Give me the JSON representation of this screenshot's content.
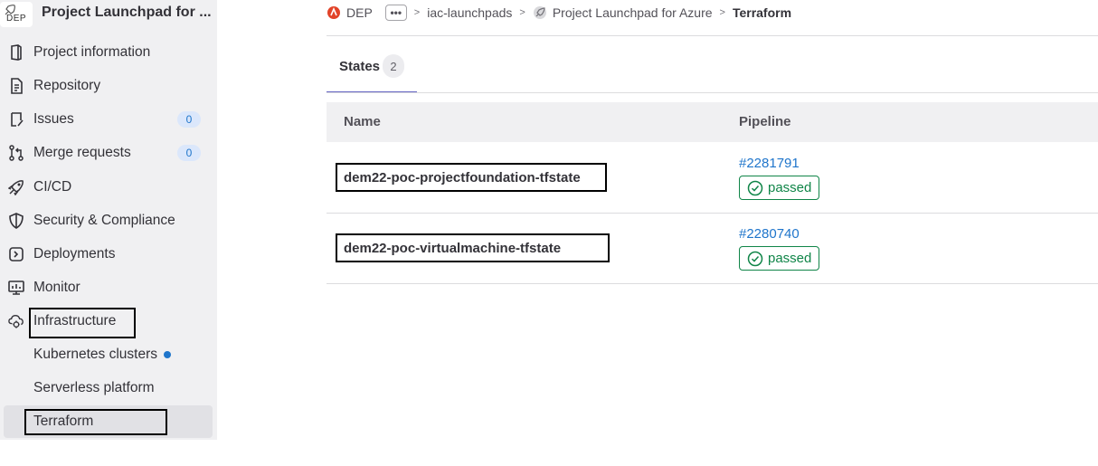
{
  "sidebar": {
    "project_avatar_text": "DEP",
    "project_title": "Project Launchpad for ...",
    "items": [
      {
        "label": "Project information",
        "icon": "project-info-icon"
      },
      {
        "label": "Repository",
        "icon": "repository-icon"
      },
      {
        "label": "Issues",
        "icon": "issues-icon",
        "badge": "0"
      },
      {
        "label": "Merge requests",
        "icon": "merge-request-icon",
        "badge": "0"
      },
      {
        "label": "CI/CD",
        "icon": "rocket-icon"
      },
      {
        "label": "Security & Compliance",
        "icon": "shield-icon"
      },
      {
        "label": "Deployments",
        "icon": "deployments-icon"
      },
      {
        "label": "Monitor",
        "icon": "monitor-icon"
      },
      {
        "label": "Infrastructure",
        "icon": "cloud-gear-icon"
      }
    ],
    "subitems": [
      {
        "label": "Kubernetes clusters",
        "has_dot": true
      },
      {
        "label": "Serverless platform"
      },
      {
        "label": "Terraform",
        "active": true
      }
    ]
  },
  "breadcrumb": {
    "group": "DEP",
    "ellipsis": "•••",
    "subgroup": "iac-launchpads",
    "project": "Project Launchpad for Azure",
    "current": "Terraform"
  },
  "tabs": {
    "states_label": "States",
    "states_count": "2"
  },
  "table": {
    "headers": {
      "name": "Name",
      "pipeline": "Pipeline"
    },
    "rows": [
      {
        "name": "dem22-poc-projectfoundation-tfstate",
        "pipeline": "#2281791",
        "status": "passed"
      },
      {
        "name": "dem22-poc-virtualmachine-tfstate",
        "pipeline": "#2280740",
        "status": "passed"
      }
    ]
  },
  "colors": {
    "accent": "#6666c4",
    "link": "#1f75cb",
    "success": "#108548",
    "sidebar_bg": "#f0f0f2"
  }
}
